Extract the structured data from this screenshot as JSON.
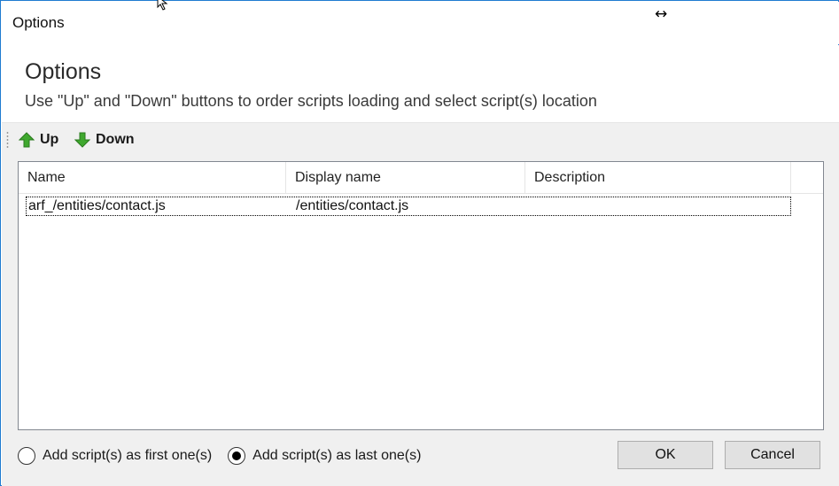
{
  "window": {
    "title": "Options"
  },
  "header": {
    "title": "Options",
    "subtitle": "Use \"Up\" and \"Down\" buttons to order scripts loading and select script(s) location"
  },
  "toolbar": {
    "up_label": "Up",
    "down_label": "Down",
    "up_icon": "arrow-up-green-icon",
    "down_icon": "arrow-down-green-icon"
  },
  "list": {
    "columns": [
      "Name",
      "Display name",
      "Description"
    ],
    "rows": [
      {
        "name": "arf_/entities/contact.js",
        "display_name": "/entities/contact.js",
        "description": ""
      }
    ]
  },
  "location": {
    "first_label": "Add script(s) as first one(s)",
    "last_label": "Add script(s) as last one(s)",
    "selected": "last"
  },
  "buttons": {
    "ok_label": "OK",
    "cancel_label": "Cancel"
  },
  "colors": {
    "window_border": "#1f7bd0",
    "arrow_green": "#3fa82e",
    "body_bg": "#f0f0f0"
  }
}
